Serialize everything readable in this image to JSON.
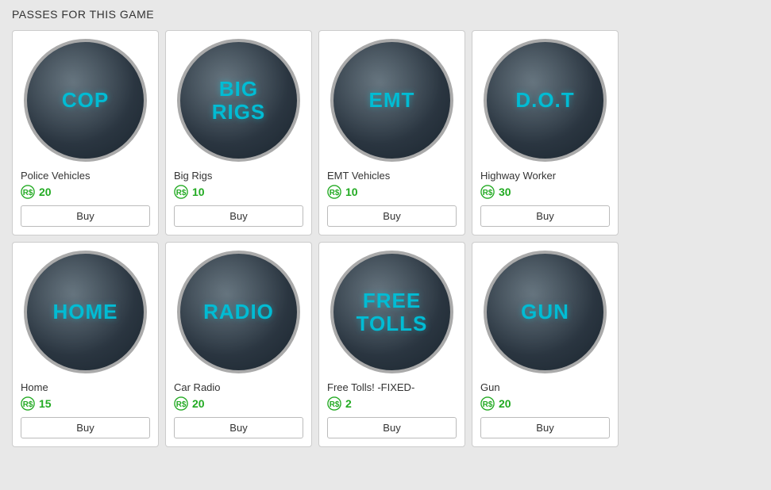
{
  "page": {
    "title": "PASSES FOR THIS GAME"
  },
  "passes": [
    {
      "id": "cop",
      "icon_text": "COP",
      "name": "Police Vehicles",
      "price": 20,
      "buy_label": "Buy"
    },
    {
      "id": "big-rigs",
      "icon_text": "BIG\nRIGS",
      "name": "Big Rigs",
      "price": 10,
      "buy_label": "Buy"
    },
    {
      "id": "emt",
      "icon_text": "EMT",
      "name": "EMT Vehicles",
      "price": 10,
      "buy_label": "Buy"
    },
    {
      "id": "dot",
      "icon_text": "D.O.T",
      "name": "Highway Worker",
      "price": 30,
      "buy_label": "Buy"
    },
    {
      "id": "home",
      "icon_text": "HOME",
      "name": "Home",
      "price": 15,
      "buy_label": "Buy"
    },
    {
      "id": "radio",
      "icon_text": "RADIO",
      "name": "Car Radio",
      "price": 20,
      "buy_label": "Buy"
    },
    {
      "id": "free-tolls",
      "icon_text": "FREE\nTOLLS",
      "name": "Free Tolls! -FIXED-",
      "price": 2,
      "buy_label": "Buy"
    },
    {
      "id": "gun",
      "icon_text": "GUN",
      "name": "Gun",
      "price": 20,
      "buy_label": "Buy"
    }
  ],
  "labels": {
    "buy": "Buy"
  }
}
